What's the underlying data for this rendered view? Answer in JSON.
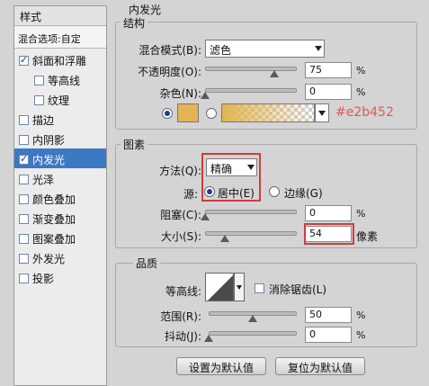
{
  "left": {
    "title": "样式",
    "blend_options": "混合选项:自定",
    "items": [
      {
        "label": "斜面和浮雕",
        "checked": true
      },
      {
        "label": "等高线",
        "checked": false
      },
      {
        "label": "纹理",
        "checked": false
      },
      {
        "label": "描边",
        "checked": false
      },
      {
        "label": "内阴影",
        "checked": false
      },
      {
        "label": "内发光",
        "checked": true
      },
      {
        "label": "光泽",
        "checked": false
      },
      {
        "label": "颜色叠加",
        "checked": false
      },
      {
        "label": "渐变叠加",
        "checked": false
      },
      {
        "label": "图案叠加",
        "checked": false
      },
      {
        "label": "外发光",
        "checked": false
      },
      {
        "label": "投影",
        "checked": false
      }
    ]
  },
  "panel": {
    "title": "内发光",
    "structure": {
      "title": "结构",
      "blend_mode_label": "混合模式(B):",
      "blend_mode_value": "滤色",
      "opacity_label": "不透明度(O):",
      "opacity_value": "75",
      "opacity_level": 0.75,
      "noise_label": "杂色(N):",
      "noise_value": "0",
      "noise_level": 0.0,
      "color_hex_text": "#e2b452",
      "swatch_color": "#e2b452"
    },
    "elements": {
      "title": "图素",
      "method_label": "方法(Q):",
      "method_value": "精确",
      "source_label": "源:",
      "center_label": "居中(E)",
      "edge_label": "边缘(G)",
      "choke_label": "阻塞(C):",
      "choke_value": "0",
      "choke_level": 0.0,
      "size_label": "大小(S):",
      "size_value": "54",
      "size_unit": "像素",
      "size_level": 0.22
    },
    "quality": {
      "title": "品质",
      "contour_label": "等高线:",
      "antialias_label": "消除锯齿(L)",
      "range_label": "范围(R):",
      "range_value": "50",
      "range_level": 0.5,
      "jitter_label": "抖动(J):",
      "jitter_value": "0",
      "jitter_level": 0.0
    },
    "percent": "%",
    "buttons": {
      "set_default": "设置为默认值",
      "reset_default": "复位为默认值"
    }
  }
}
